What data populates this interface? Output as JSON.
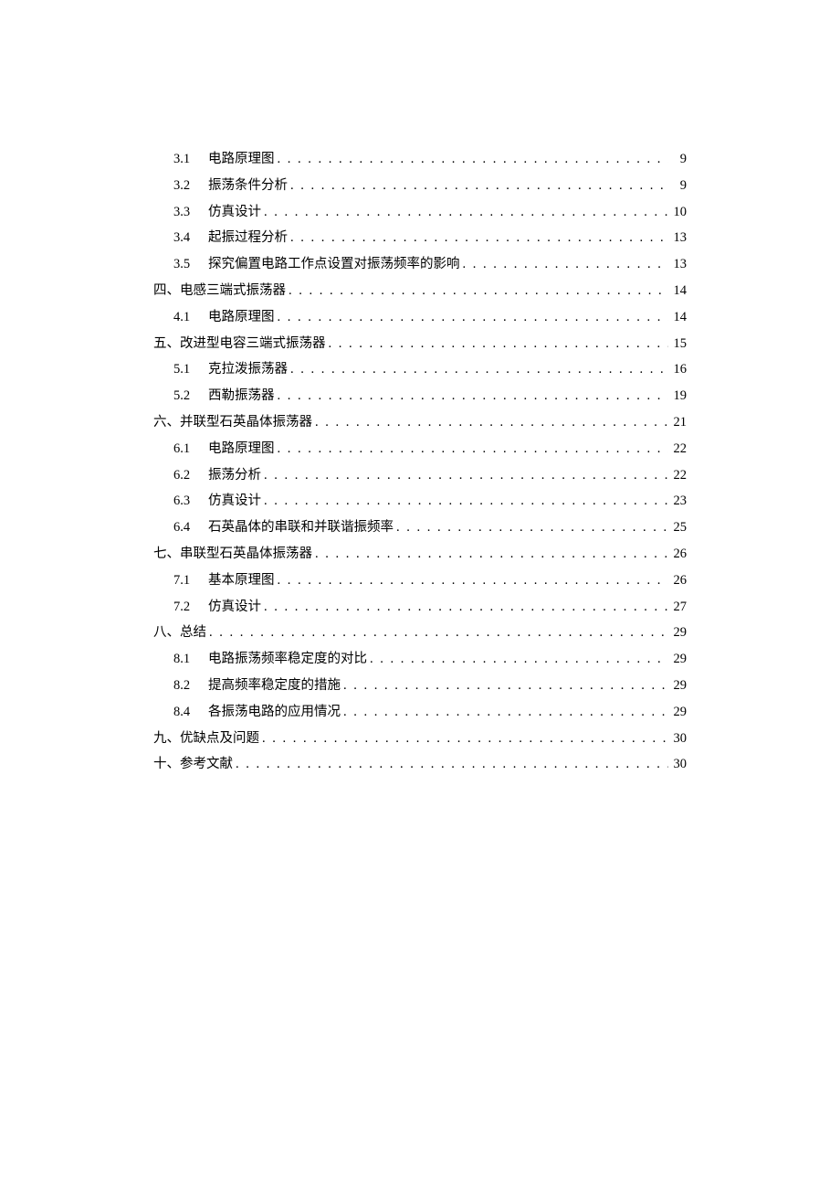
{
  "toc": [
    {
      "level": 2,
      "num": "3.1",
      "title": "电路原理图",
      "page": "9"
    },
    {
      "level": 2,
      "num": "3.2",
      "title": "振荡条件分析",
      "page": "9"
    },
    {
      "level": 2,
      "num": "3.3",
      "title": "仿真设计",
      "page": "10"
    },
    {
      "level": 2,
      "num": "3.4",
      "title": "起振过程分析",
      "page": "13"
    },
    {
      "level": 2,
      "num": "3.5",
      "title": "探究偏置电路工作点设置对振荡频率的影响",
      "page": "13"
    },
    {
      "level": 1,
      "num": "四、",
      "title": "电感三端式振荡器",
      "page": "14"
    },
    {
      "level": 2,
      "num": "4.1",
      "title": "电路原理图",
      "page": "14"
    },
    {
      "level": 1,
      "num": "五、",
      "title": "改进型电容三端式振荡器",
      "page": "15"
    },
    {
      "level": 2,
      "num": "5.1",
      "title": "克拉泼振荡器",
      "page": "16"
    },
    {
      "level": 2,
      "num": "5.2",
      "title": "西勒振荡器",
      "page": "19"
    },
    {
      "level": 1,
      "num": "六、",
      "title": "并联型石英晶体振荡器",
      "page": "21"
    },
    {
      "level": 2,
      "num": "6.1",
      "title": "电路原理图",
      "page": "22"
    },
    {
      "level": 2,
      "num": "6.2",
      "title": "振荡分析",
      "page": "22"
    },
    {
      "level": 2,
      "num": "6.3",
      "title": "仿真设计",
      "page": "23"
    },
    {
      "level": 2,
      "num": "6.4",
      "title": "石英晶体的串联和并联谐振频率",
      "page": "25"
    },
    {
      "level": 1,
      "num": "七、",
      "title": "串联型石英晶体振荡器",
      "page": "26"
    },
    {
      "level": 2,
      "num": "7.1",
      "title": "基本原理图",
      "page": "26"
    },
    {
      "level": 2,
      "num": "7.2",
      "title": "仿真设计",
      "page": "27"
    },
    {
      "level": 1,
      "num": "八、",
      "title": "总结",
      "page": "29"
    },
    {
      "level": 2,
      "num": "8.1",
      "title": "电路振荡频率稳定度的对比",
      "page": "29"
    },
    {
      "level": 2,
      "num": "8.2",
      "title": "提高频率稳定度的措施",
      "page": "29"
    },
    {
      "level": 2,
      "num": "8.4",
      "title": "各振荡电路的应用情况",
      "page": "29"
    },
    {
      "level": 1,
      "num": "九、",
      "title": "优缺点及问题",
      "page": "30"
    },
    {
      "level": 1,
      "num": "十、",
      "title": "参考文献",
      "page": "30"
    }
  ]
}
